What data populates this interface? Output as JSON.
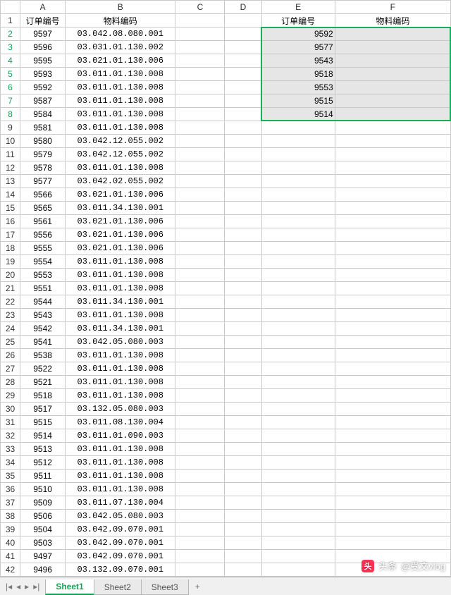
{
  "columns": [
    "A",
    "B",
    "C",
    "D",
    "E",
    "F"
  ],
  "header_row": {
    "A": "订单编号",
    "B": "物料编码",
    "E": "订单编号",
    "F": "物料编码"
  },
  "rows_ab": [
    {
      "n": 2,
      "a": "9597",
      "b": "03.042.08.080.001"
    },
    {
      "n": 3,
      "a": "9596",
      "b": "03.031.01.130.002"
    },
    {
      "n": 4,
      "a": "9595",
      "b": "03.021.01.130.006"
    },
    {
      "n": 5,
      "a": "9593",
      "b": "03.011.01.130.008"
    },
    {
      "n": 6,
      "a": "9592",
      "b": "03.011.01.130.008"
    },
    {
      "n": 7,
      "a": "9587",
      "b": "03.011.01.130.008"
    },
    {
      "n": 8,
      "a": "9584",
      "b": "03.011.01.130.008"
    },
    {
      "n": 9,
      "a": "9581",
      "b": "03.011.01.130.008"
    },
    {
      "n": 10,
      "a": "9580",
      "b": "03.042.12.055.002"
    },
    {
      "n": 11,
      "a": "9579",
      "b": "03.042.12.055.002"
    },
    {
      "n": 12,
      "a": "9578",
      "b": "03.011.01.130.008"
    },
    {
      "n": 13,
      "a": "9577",
      "b": "03.042.02.055.002"
    },
    {
      "n": 14,
      "a": "9566",
      "b": "03.021.01.130.006"
    },
    {
      "n": 15,
      "a": "9565",
      "b": "03.011.34.130.001"
    },
    {
      "n": 16,
      "a": "9561",
      "b": "03.021.01.130.006"
    },
    {
      "n": 17,
      "a": "9556",
      "b": "03.021.01.130.006"
    },
    {
      "n": 18,
      "a": "9555",
      "b": "03.021.01.130.006"
    },
    {
      "n": 19,
      "a": "9554",
      "b": "03.011.01.130.008"
    },
    {
      "n": 20,
      "a": "9553",
      "b": "03.011.01.130.008"
    },
    {
      "n": 21,
      "a": "9551",
      "b": "03.011.01.130.008"
    },
    {
      "n": 22,
      "a": "9544",
      "b": "03.011.34.130.001"
    },
    {
      "n": 23,
      "a": "9543",
      "b": "03.011.01.130.008"
    },
    {
      "n": 24,
      "a": "9542",
      "b": "03.011.34.130.001"
    },
    {
      "n": 25,
      "a": "9541",
      "b": "03.042.05.080.003"
    },
    {
      "n": 26,
      "a": "9538",
      "b": "03.011.01.130.008"
    },
    {
      "n": 27,
      "a": "9522",
      "b": "03.011.01.130.008"
    },
    {
      "n": 28,
      "a": "9521",
      "b": "03.011.01.130.008"
    },
    {
      "n": 29,
      "a": "9518",
      "b": "03.011.01.130.008"
    },
    {
      "n": 30,
      "a": "9517",
      "b": "03.132.05.080.003"
    },
    {
      "n": 31,
      "a": "9515",
      "b": "03.011.08.130.004"
    },
    {
      "n": 32,
      "a": "9514",
      "b": "03.011.01.090.003"
    },
    {
      "n": 33,
      "a": "9513",
      "b": "03.011.01.130.008"
    },
    {
      "n": 34,
      "a": "9512",
      "b": "03.011.01.130.008"
    },
    {
      "n": 35,
      "a": "9511",
      "b": "03.011.01.130.008"
    },
    {
      "n": 36,
      "a": "9510",
      "b": "03.011.01.130.008"
    },
    {
      "n": 37,
      "a": "9509",
      "b": "03.011.07.130.004"
    },
    {
      "n": 38,
      "a": "9506",
      "b": "03.042.05.080.003"
    },
    {
      "n": 39,
      "a": "9504",
      "b": "03.042.09.070.001"
    },
    {
      "n": 40,
      "a": "9503",
      "b": "03.042.09.070.001"
    },
    {
      "n": 41,
      "a": "9497",
      "b": "03.042.09.070.001"
    },
    {
      "n": 42,
      "a": "9496",
      "b": "03.132.09.070.001"
    }
  ],
  "rows_e": [
    {
      "n": 2,
      "e": "9592"
    },
    {
      "n": 3,
      "e": "9577"
    },
    {
      "n": 4,
      "e": "9543"
    },
    {
      "n": 5,
      "e": "9518"
    },
    {
      "n": 6,
      "e": "9553"
    },
    {
      "n": 7,
      "e": "9515"
    },
    {
      "n": 8,
      "e": "9514"
    }
  ],
  "selection_rows": [
    2,
    3,
    4,
    5,
    6,
    7,
    8
  ],
  "tabs": {
    "items": [
      "Sheet1",
      "Sheet2",
      "Sheet3"
    ],
    "active": 0,
    "add_label": "+"
  },
  "nav": {
    "first": "|◂",
    "prev": "◂",
    "next": "▸",
    "last": "▸|"
  },
  "watermark": {
    "logo_text": "头",
    "label": "头条",
    "handle": "@受文vlog"
  }
}
